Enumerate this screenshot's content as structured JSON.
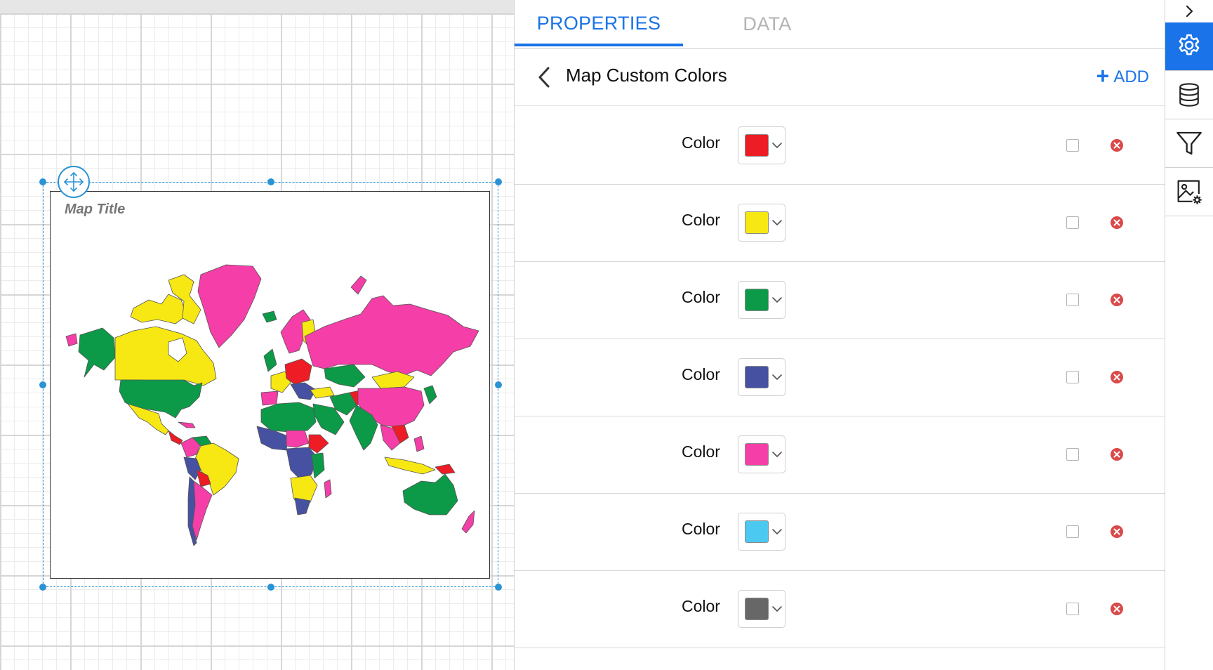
{
  "canvas": {
    "map_title": "Map Title"
  },
  "panel": {
    "tabs": [
      {
        "label": "PROPERTIES",
        "active": true
      },
      {
        "label": "DATA",
        "active": false
      }
    ],
    "title": "Map Custom Colors",
    "add_label": "ADD",
    "colors": [
      {
        "label": "Color",
        "value": "#ee1c24"
      },
      {
        "label": "Color",
        "value": "#f7e813"
      },
      {
        "label": "Color",
        "value": "#0c9a48"
      },
      {
        "label": "Color",
        "value": "#4751a1"
      },
      {
        "label": "Color",
        "value": "#f53ea7"
      },
      {
        "label": "Color",
        "value": "#4cc9f0"
      },
      {
        "label": "Color",
        "value": "#676767"
      }
    ]
  },
  "toolbar": {
    "items": [
      "gear-icon",
      "database-icon",
      "filter-icon",
      "image-settings-icon"
    ],
    "active": "gear-icon"
  },
  "theme": {
    "accent": "#1a73e8",
    "selection": "#2a93d5",
    "remove": "#d94a4a"
  }
}
